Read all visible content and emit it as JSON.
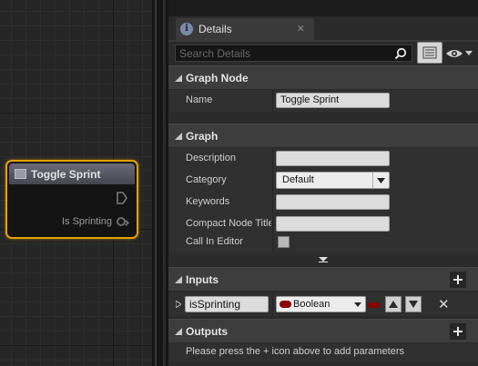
{
  "graph": {
    "node": {
      "title": "Toggle Sprint",
      "pin_label": "Is Sprinting",
      "border_color": "#e5a000"
    }
  },
  "details": {
    "tab_label": "Details",
    "search_placeholder": "Search Details",
    "sections": {
      "graph_node": {
        "title": "Graph Node",
        "name_label": "Name",
        "name_value": "Toggle Sprint"
      },
      "graph": {
        "title": "Graph",
        "description_label": "Description",
        "description_value": "",
        "category_label": "Category",
        "category_value": "Default",
        "keywords_label": "Keywords",
        "keywords_value": "",
        "compact_label": "Compact Node Title",
        "compact_value": "",
        "call_in_editor_label": "Call In Editor",
        "call_in_editor_checked": false
      },
      "inputs": {
        "title": "Inputs",
        "param_name": "isSprinting",
        "param_type": "Boolean",
        "type_color": "#8b0000"
      },
      "outputs": {
        "title": "Outputs",
        "hint": "Please press the + icon above to add parameters"
      }
    }
  }
}
